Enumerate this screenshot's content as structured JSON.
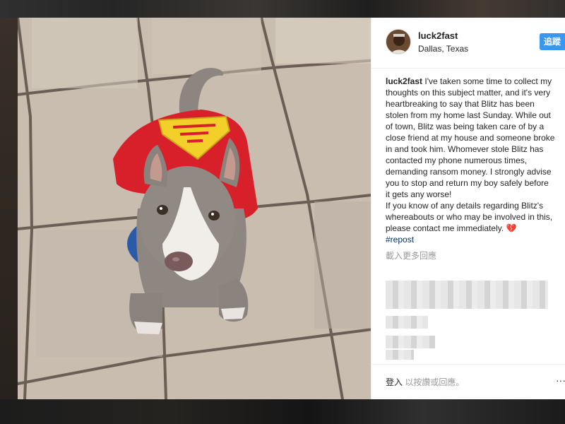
{
  "post": {
    "username": "luck2fast",
    "location": "Dallas, Texas",
    "follow_label": "追蹤",
    "caption_user": "luck2fast",
    "caption_text": "I've taken some time to collect my thoughts on this subject matter, and it's very heartbreaking to say that Blitz has been stolen from my home last Sunday. While out of town, Blitz was being taken care of by a close friend at my house and someone broke in and took him. Whomever stole Blitz has contacted my phone numerous times, demanding ransom money. I strongly advise you to stop and return my boy safely before it gets any worse!",
    "caption_text2": "If you know of any details regarding Blitz's whereabouts or who may be involved in this, please contact me immediately. 💔",
    "hashtag": "#repost",
    "load_more": "載入更多回應",
    "login_label": "登入",
    "login_suffix": " 以按讚或回應。",
    "more_icon": "···"
  },
  "icons": {
    "avatar": "profile-avatar",
    "more": "more-options-icon"
  },
  "colors": {
    "accent": "#3897f0",
    "text": "#262626",
    "muted": "#999999",
    "hashtag": "#003569"
  }
}
